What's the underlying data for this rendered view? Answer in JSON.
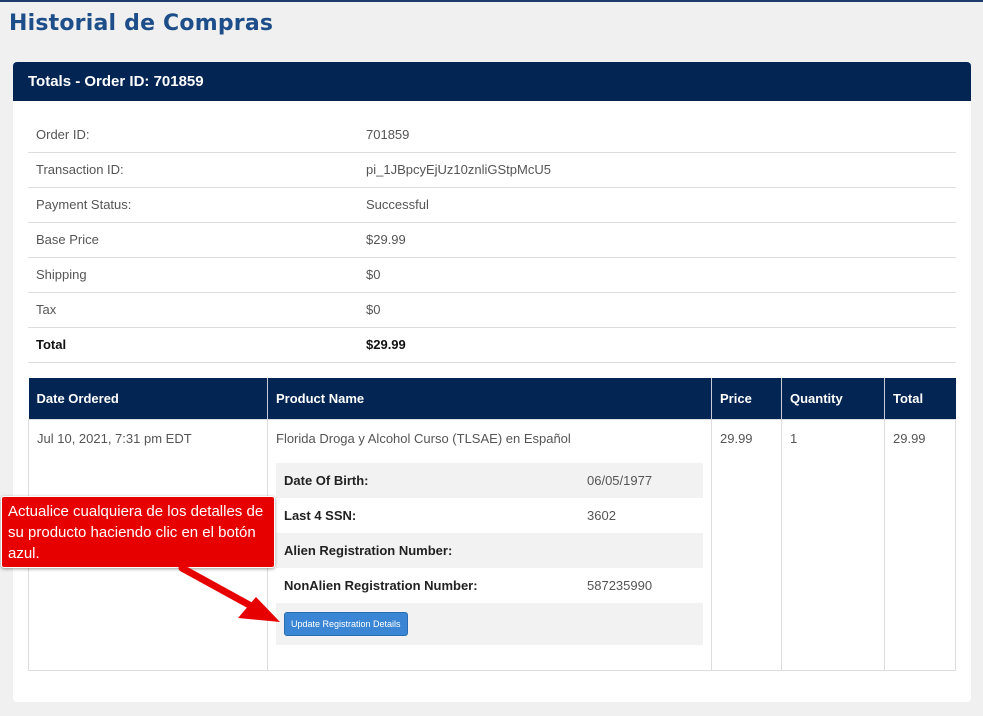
{
  "page_title": "Historial de Compras",
  "panel_title": "Totals - Order ID: 701859",
  "summary": [
    {
      "label": "Order ID:",
      "value": "701859"
    },
    {
      "label": "Transaction ID:",
      "value": "pi_1JBpcyEjUz10znliGStpMcU5"
    },
    {
      "label": "Payment Status:",
      "value": "Successful"
    },
    {
      "label": "Base Price",
      "value": "$29.99"
    },
    {
      "label": "Shipping",
      "value": "$0"
    },
    {
      "label": "Tax",
      "value": "$0"
    },
    {
      "label": "Total",
      "value": "$29.99"
    }
  ],
  "orders": {
    "headers": [
      "Date Ordered",
      "Product Name",
      "Price",
      "Quantity",
      "Total"
    ],
    "row": {
      "date": "Jul 10, 2021, 7:31 pm EDT",
      "product": "Florida Droga y Alcohol Curso (TLSAE) en Español",
      "price": "29.99",
      "quantity": "1",
      "total": "29.99",
      "details": [
        {
          "label": "Date Of Birth:",
          "value": "06/05/1977"
        },
        {
          "label": "Last 4 SSN:",
          "value": "3602"
        },
        {
          "label": "Alien Registration Number:",
          "value": ""
        },
        {
          "label": "NonAlien Registration Number:",
          "value": "587235990"
        }
      ],
      "button_label": "Update Registration Details"
    }
  },
  "callout_text": "Actualice cualquiera de los detalles de su producto haciendo clic en el botón azul.",
  "colors": {
    "header_navy": "#032553",
    "title_blue": "#1d4e89",
    "callout_red": "#e60000",
    "button_blue": "#3b86d4"
  }
}
